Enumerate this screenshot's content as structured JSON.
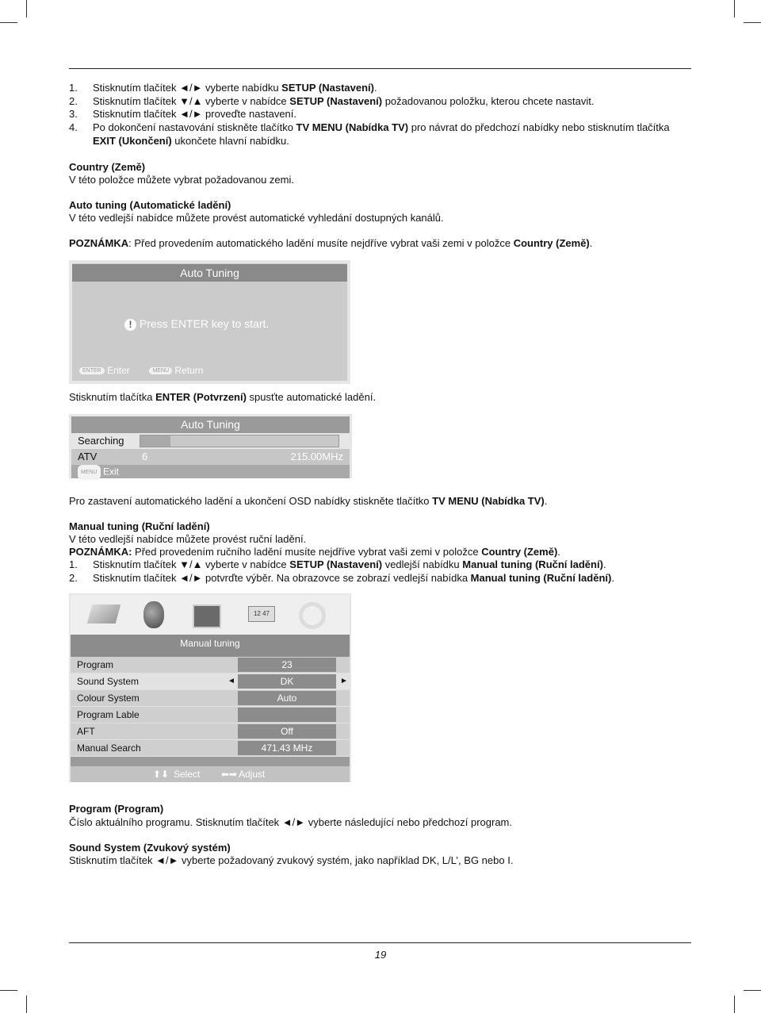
{
  "text": {
    "l1n": [
      [
        "1.",
        0
      ]
    ],
    "l1": [
      [
        "Stisknutím tlačítek ◄/► vyberte nabídku ",
        0
      ],
      [
        "SETUP (Nastavení)",
        1
      ],
      [
        ".",
        0
      ]
    ],
    "l2n": [
      [
        "2.",
        0
      ]
    ],
    "l2": [
      [
        "Stisknutím tlačítek ▼/▲ vyberte v nabídce ",
        0
      ],
      [
        "SETUP (Nastavení)",
        1
      ],
      [
        " požadovanou položku, kterou chcete nastavit.",
        0
      ]
    ],
    "l3n": [
      [
        "3.",
        0
      ]
    ],
    "l3": [
      [
        "Stisknutím tlačítek ◄/► proveďte nastavení.",
        0
      ]
    ],
    "l4n": [
      [
        "4.",
        0
      ]
    ],
    "l4a": [
      [
        "Po dokončení nastavování stiskněte tlačítko ",
        0
      ],
      [
        "TV MENU (Nabídka TV)",
        1
      ],
      [
        " pro návrat do předchozí nabídky nebo stisknutím tlačítka",
        0
      ]
    ],
    "l4b": [
      [
        "EXIT (Ukončení)",
        1
      ],
      [
        " ukončete hlavní nabídku.",
        0
      ]
    ],
    "country_h": [
      [
        "Country (Země)",
        1
      ]
    ],
    "country_t": [
      [
        "V této položce můžete vybrat požadovanou zemi.",
        0
      ]
    ],
    "auto_h": [
      [
        "Auto tuning (Automatické ladění)",
        1
      ]
    ],
    "auto_t": [
      [
        "V této vedlejší nabídce můžete provést automatické vyhledání dostupných kanálů.",
        0
      ]
    ],
    "note1": [
      [
        "POZNÁMKA",
        1
      ],
      [
        ": Před provedením automatického ladění musíte nejdříve vybrat vaši zemi v položce ",
        0
      ],
      [
        "Country (Země)",
        1
      ],
      [
        ".",
        0
      ]
    ],
    "enter_t": [
      [
        "Stisknutím tlačítka ",
        0
      ],
      [
        "ENTER (Potvrzení)",
        1
      ],
      [
        " spusťte automatické ladění.",
        0
      ]
    ],
    "stop_t": [
      [
        "Pro zastavení automatického ladění a ukončení OSD nabídky stiskněte tlačítko ",
        0
      ],
      [
        "TV MENU (Nabídka TV)",
        1
      ],
      [
        ".",
        0
      ]
    ],
    "manual_h": [
      [
        "Manual tuning (Ruční ladění)",
        1
      ]
    ],
    "manual_t": [
      [
        "V této vedlejší nabídce můžete provést ruční ladění.",
        0
      ]
    ],
    "note2": [
      [
        "POZNÁMKA:",
        1
      ],
      [
        " Před provedením ručního ladění musíte nejdříve vybrat vaši zemi v položce ",
        0
      ],
      [
        "Country (Země)",
        1
      ],
      [
        ".",
        0
      ]
    ],
    "m1n": [
      [
        "1.",
        0
      ]
    ],
    "m1": [
      [
        "Stisknutím tlačítek ▼/▲ vyberte v nabídce ",
        0
      ],
      [
        "SETUP (Nastavení)",
        1
      ],
      [
        " vedlejší nabídku ",
        0
      ],
      [
        "Manual tuning (Ruční ladění)",
        1
      ],
      [
        ".",
        0
      ]
    ],
    "m2n": [
      [
        "2.",
        0
      ]
    ],
    "m2": [
      [
        "Stisknutím tlačítek ◄/► potvrďte výběr. Na obrazovce se zobrazí vedlejší nabídka ",
        0
      ],
      [
        "Manual tuning (Ruční ladění)",
        1
      ],
      [
        ".",
        0
      ]
    ],
    "prog_h": [
      [
        "Program (Program)",
        1
      ]
    ],
    "prog_t": [
      [
        "Číslo aktuálního programu. Stisknutím tlačítek ◄/► vyberte následující nebo předchozí program.",
        0
      ]
    ],
    "sound_h": [
      [
        "Sound System (Zvukový systém)",
        1
      ]
    ],
    "sound_t": [
      [
        "Stisknutím tlačítek ◄/► vyberte požadovaný zvukový systém, jako například DK, L/L’, BG nebo I.",
        0
      ]
    ]
  },
  "osd1": {
    "title": "Auto Tuning",
    "message": "Press ENTER key to start.",
    "icon": "exclamation-icon",
    "enter_key": "ENTER",
    "enter_label": "Enter",
    "menu_key": "MENU",
    "menu_label": "Return"
  },
  "osd2": {
    "title": "Auto Tuning",
    "searching": "Searching",
    "progress_percent": 15,
    "band": "ATV",
    "channel": "6",
    "frequency": "215.00MHz",
    "menu_key": "MENU",
    "exit_label": "Exit"
  },
  "osd3": {
    "icons": [
      "picture-icon",
      "sound-icon",
      "screen-icon",
      "clock-icon",
      "setup-gear-icon"
    ],
    "title": "Manual tuning",
    "rows": [
      {
        "label": "Program",
        "value": "23"
      },
      {
        "label": "Sound System",
        "value": "DK",
        "selected": true
      },
      {
        "label": "Colour System",
        "value": "Auto"
      },
      {
        "label": "Program Lable",
        "value": ""
      },
      {
        "label": "AFT",
        "value": "Off"
      },
      {
        "label": "Manual Search",
        "value": "471.43 MHz"
      }
    ],
    "select_label": "Select",
    "adjust_label": "Adjust"
  },
  "page_number": "19"
}
